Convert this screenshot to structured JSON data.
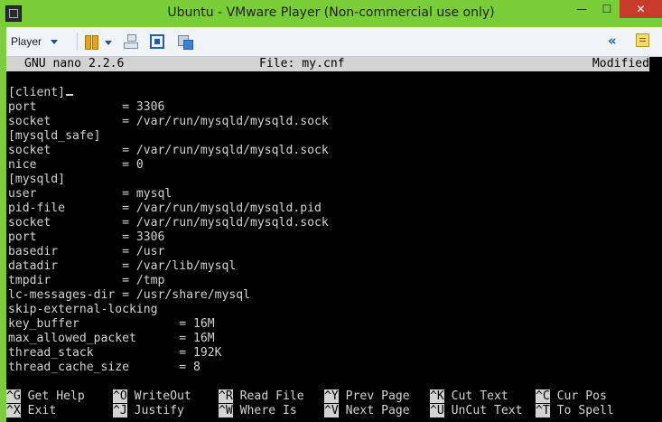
{
  "window": {
    "title": "Ubuntu - VMware Player (Non-commercial use only)",
    "minimize_glyph": "—",
    "maximize_glyph": "☐",
    "close_glyph": "✕"
  },
  "toolbar": {
    "player_label": "Player",
    "collapse_glyph": "«"
  },
  "nano": {
    "version": "GNU nano 2.2.6",
    "file": "File: my.cnf",
    "status": "Modified"
  },
  "editor_lines": [
    "[client]",
    "port            = 3306",
    "socket          = /var/run/mysqld/mysqld.sock",
    "[mysqld_safe]",
    "socket          = /var/run/mysqld/mysqld.sock",
    "nice            = 0",
    "[mysqld]",
    "user            = mysql",
    "pid-file        = /var/run/mysqld/mysqld.pid",
    "socket          = /var/run/mysqld/mysqld.sock",
    "port            = 3306",
    "basedir         = /usr",
    "datadir         = /var/lib/mysql",
    "tmpdir          = /tmp",
    "lc-messages-dir = /usr/share/mysql",
    "skip-external-locking",
    "key_buffer              = 16M",
    "max_allowed_packet      = 16M",
    "thread_stack            = 192K",
    "thread_cache_size       = 8"
  ],
  "shortcuts": {
    "row1": [
      {
        "key": "^G",
        "label": " Get Help"
      },
      {
        "key": "^O",
        "label": " WriteOut"
      },
      {
        "key": "^R",
        "label": " Read File"
      },
      {
        "key": "^Y",
        "label": " Prev Page"
      },
      {
        "key": "^K",
        "label": " Cut Text"
      },
      {
        "key": "^C",
        "label": " Cur Pos"
      }
    ],
    "row2": [
      {
        "key": "^X",
        "label": " Exit"
      },
      {
        "key": "^J",
        "label": " Justify"
      },
      {
        "key": "^W",
        "label": " Where Is"
      },
      {
        "key": "^V",
        "label": " Next Page"
      },
      {
        "key": "^U",
        "label": " UnCut Text"
      },
      {
        "key": "^T",
        "label": " To Spell"
      }
    ]
  }
}
